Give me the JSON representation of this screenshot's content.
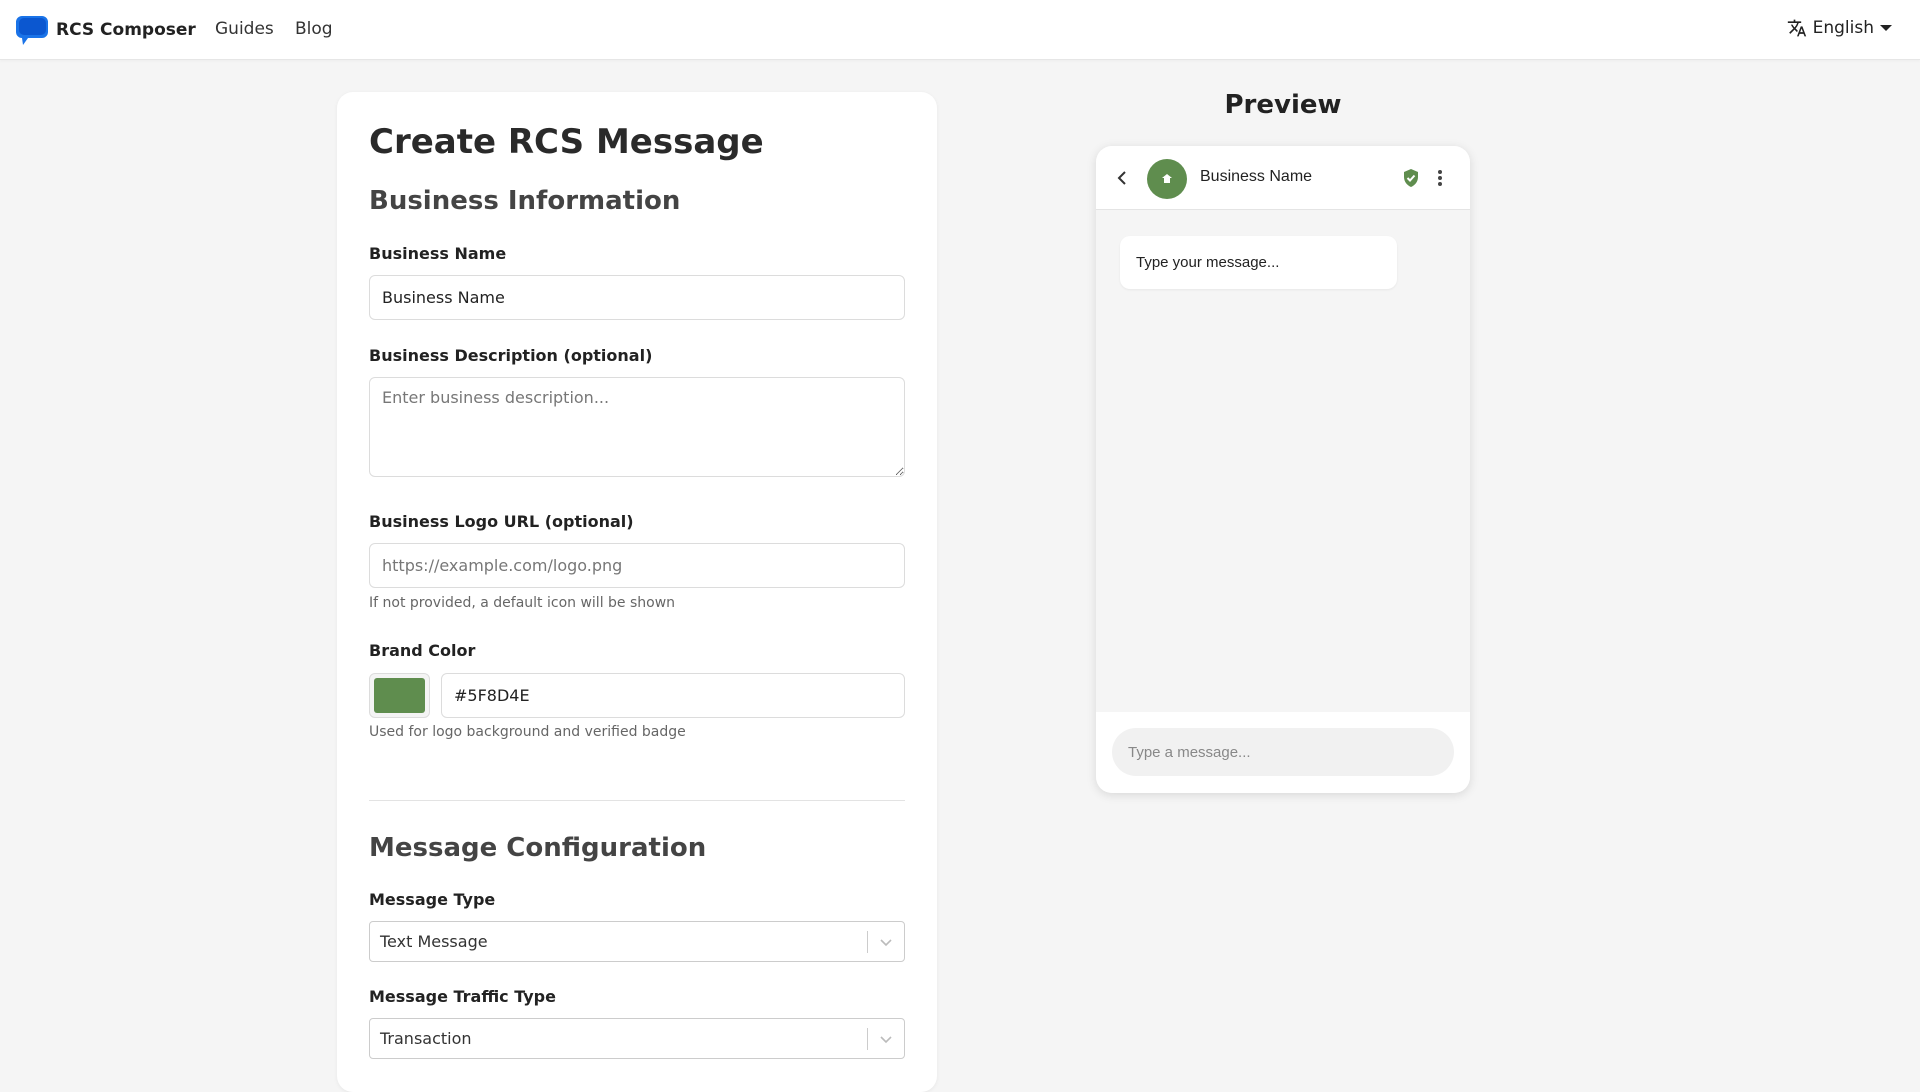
{
  "nav": {
    "brand": "RCS Composer",
    "links": [
      "Guides",
      "Blog"
    ],
    "language": "English"
  },
  "form": {
    "title": "Create RCS Message",
    "business_section": "Business Information",
    "business_name": {
      "label": "Business Name",
      "value": "Business Name"
    },
    "business_description": {
      "label": "Business Description (optional)",
      "placeholder": "Enter business description..."
    },
    "business_logo": {
      "label": "Business Logo URL (optional)",
      "placeholder": "https://example.com/logo.png",
      "help": "If not provided, a default icon will be shown"
    },
    "brand_color": {
      "label": "Brand Color",
      "value": "#5F8D4E",
      "help": "Used for logo background and verified badge"
    },
    "message_section": "Message Configuration",
    "message_type": {
      "label": "Message Type",
      "value": "Text Message"
    },
    "traffic_type": {
      "label": "Message Traffic Type",
      "value": "Transaction"
    }
  },
  "preview": {
    "title": "Preview",
    "business_name": "Business Name",
    "bubble_text": "Type your message...",
    "compose_placeholder": "Type a message..."
  },
  "colors": {
    "brand": "#5F8D4E",
    "logo_blue": "#1a73e8"
  }
}
